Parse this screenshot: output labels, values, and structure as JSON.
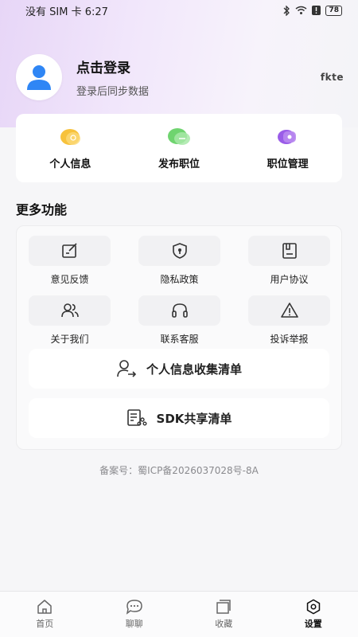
{
  "status_bar": {
    "left_text": "没有 SIM 卡 6:27",
    "battery": "78"
  },
  "profile": {
    "title": "点击登录",
    "subtitle": "登录后同步数据",
    "brand": "fkte"
  },
  "quick_actions": [
    {
      "label": "个人信息",
      "icon": "personal-info-icon"
    },
    {
      "label": "发布职位",
      "icon": "post-job-icon"
    },
    {
      "label": "职位管理",
      "icon": "job-manage-icon"
    }
  ],
  "more": {
    "title": "更多功能",
    "items": [
      {
        "label": "意见反馈",
        "icon": "feedback-icon"
      },
      {
        "label": "隐私政策",
        "icon": "privacy-shield-icon"
      },
      {
        "label": "用户协议",
        "icon": "agreement-icon"
      },
      {
        "label": "关于我们",
        "icon": "about-users-icon"
      },
      {
        "label": "联系客服",
        "icon": "headset-icon"
      },
      {
        "label": "投诉举报",
        "icon": "warning-icon"
      }
    ],
    "personal_info_list": "个人信息收集清单",
    "sdk_list": "SDK共享清单"
  },
  "record": "备案号：蜀ICP备2026037028号-8A",
  "tabs": [
    {
      "label": "首页",
      "icon": "home-icon",
      "active": false
    },
    {
      "label": "聊聊",
      "icon": "chat-icon",
      "active": false
    },
    {
      "label": "收藏",
      "icon": "favorites-icon",
      "active": false
    },
    {
      "label": "设置",
      "icon": "settings-icon",
      "active": true
    }
  ],
  "colors": {
    "accent_blue": "#2f86f5",
    "tab_active": "#111111",
    "hero_purple": "#e7d6f7"
  }
}
